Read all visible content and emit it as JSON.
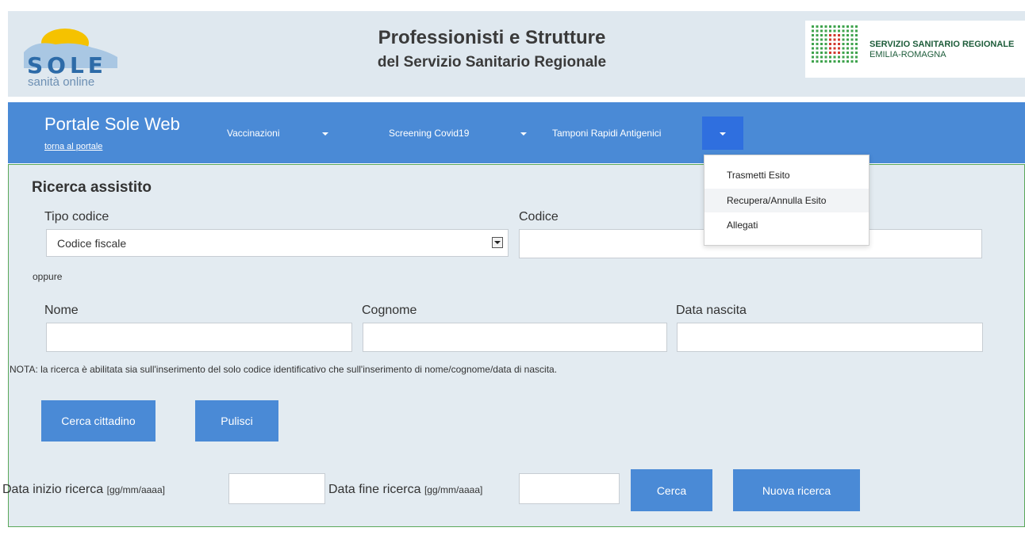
{
  "header": {
    "logo_letters": "SOLE",
    "logo_sub": "sanità online",
    "title_line1": "Professionisti e Strutture",
    "title_line2": "del Servizio Sanitario Regionale",
    "ssr_line1": "SERVIZIO SANITARIO REGIONALE",
    "ssr_line2": "EMILIA-ROMAGNA"
  },
  "nav": {
    "brand": "Portale Sole Web",
    "back_link": "torna al portale",
    "items": [
      {
        "label": "Vaccinazioni"
      },
      {
        "label": "Screening Covid19"
      },
      {
        "label": "Tamponi Rapidi Antigenici"
      }
    ],
    "dropdown": [
      "Trasmetti Esito",
      "Recupera/Annulla Esito",
      "Allegati"
    ]
  },
  "search": {
    "title": "Ricerca assistito",
    "tipo_codice_label": "Tipo codice",
    "tipo_codice_value": "Codice fiscale",
    "codice_label": "Codice",
    "codice_value": "",
    "oppure": "oppure",
    "nome_label": "Nome",
    "cognome_label": "Cognome",
    "data_nascita_label": "Data nascita",
    "nome_value": "",
    "cognome_value": "",
    "data_nascita_value": "",
    "nota": "NOTA: la ricerca è abilitata sia sull'inserimento del solo codice identificativo che sull'inserimento di nome/cognome/data di nascita.",
    "cerca_cittadino": "Cerca cittadino",
    "pulisci": "Pulisci"
  },
  "date_search": {
    "inizio_label": "Data inizio ricerca",
    "fine_label": "Data fine ricerca",
    "format": "[gg/mm/aaaa]",
    "inizio_value": "",
    "fine_value": "",
    "cerca": "Cerca",
    "nuova_ricerca": "Nuova ricerca"
  },
  "colors": {
    "nav_bg": "#4a8ad6",
    "nav_active": "#2f6fdf",
    "panel_bg": "#e3ebf1",
    "panel_border": "#5aa85a",
    "header_bg": "#dfe8ef"
  }
}
